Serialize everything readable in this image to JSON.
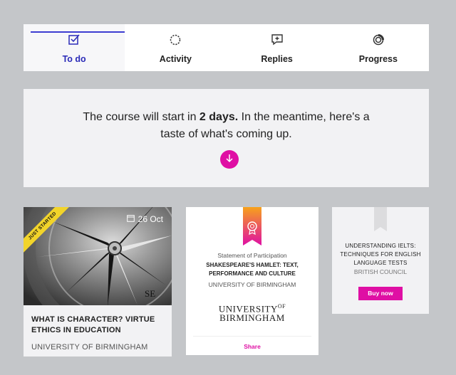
{
  "tabs": [
    {
      "label": "To do",
      "icon": "checkbox-icon",
      "active": true
    },
    {
      "label": "Activity",
      "icon": "dotted-circle-icon",
      "active": false
    },
    {
      "label": "Replies",
      "icon": "reply-bubble-icon",
      "active": false
    },
    {
      "label": "Progress",
      "icon": "progress-ring-icon",
      "active": false
    }
  ],
  "banner": {
    "text_before": "The course will start in ",
    "highlight": "2 days.",
    "text_after": " In the meantime, here's a taste of what's coming up."
  },
  "course_card": {
    "ribbon": "JUST STARTED",
    "date": "26 Oct",
    "title": "WHAT IS CHARACTER? VIRTUE ETHICS IN EDUCATION",
    "org": "UNIVERSITY OF BIRMINGHAM"
  },
  "statement_card": {
    "label": "Statement of Participation",
    "title": "SHAKESPEARE'S HAMLET: TEXT, PERFORMANCE AND CULTURE",
    "org": "UNIVERSITY OF BIRMINGHAM",
    "logo_line1": "UNIVERSITY",
    "logo_sup": "OF",
    "logo_line2": "BIRMINGHAM",
    "share": "Share"
  },
  "ielts_card": {
    "title": "UNDERSTANDING IELTS: TECHNIQUES FOR ENGLISH LANGUAGE TESTS",
    "org": "BRITISH COUNCIL",
    "buy": "Buy now"
  },
  "colors": {
    "accent": "#df0fa4",
    "tab_active": "#2b2bb8",
    "ribbon": "#f2d42a"
  }
}
